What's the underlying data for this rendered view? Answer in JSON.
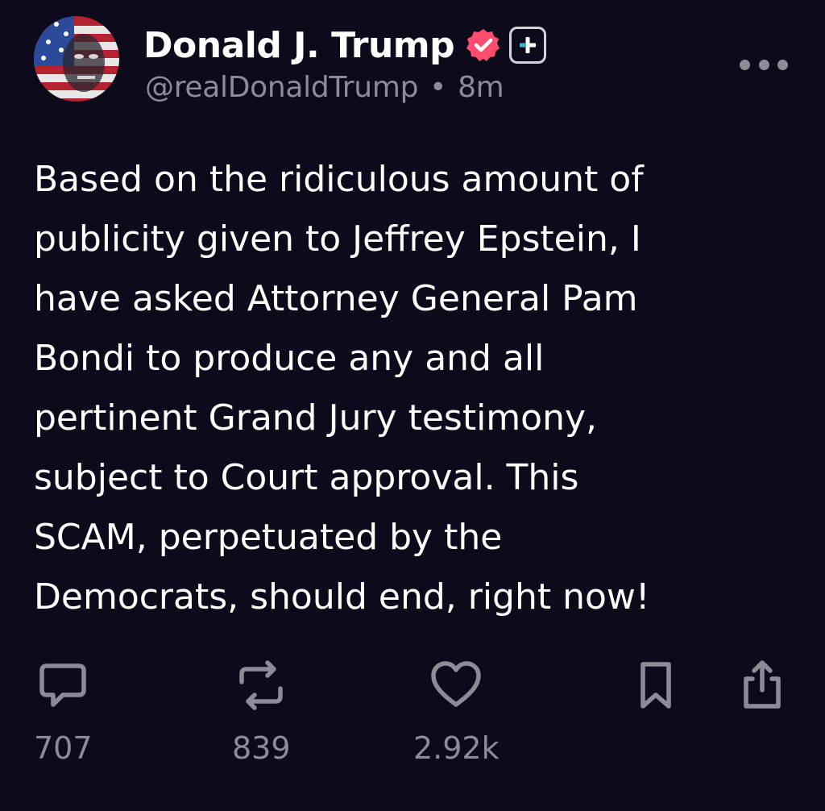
{
  "post": {
    "author": {
      "display_name": "Donald J. Trump",
      "handle": "@realDonaldTrump",
      "separator": "•",
      "time_ago": "8m",
      "verified_color": "#ff4d6d"
    },
    "body_lines": [
      "Based on the ridiculous amount of",
      "publicity given to Jeffrey Epstein, I",
      "have asked Attorney General Pam",
      "Bondi to produce any and all",
      "pertinent Grand Jury testimony,",
      "subject to Court approval. This",
      "SCAM, perpetuated by the",
      "Democrats, should end, right now!"
    ],
    "actions": {
      "reply": {
        "icon": "comment-icon",
        "count": "707"
      },
      "repost": {
        "icon": "repost-icon",
        "count": "839"
      },
      "like": {
        "icon": "heart-icon",
        "count": "2.92k"
      },
      "bookmark": {
        "icon": "bookmark-icon"
      },
      "share": {
        "icon": "share-icon"
      }
    },
    "more_icon": "more-options-icon"
  },
  "colors": {
    "background": "#0d0a1b",
    "text": "#ffffff",
    "muted": "#8e8b99"
  }
}
